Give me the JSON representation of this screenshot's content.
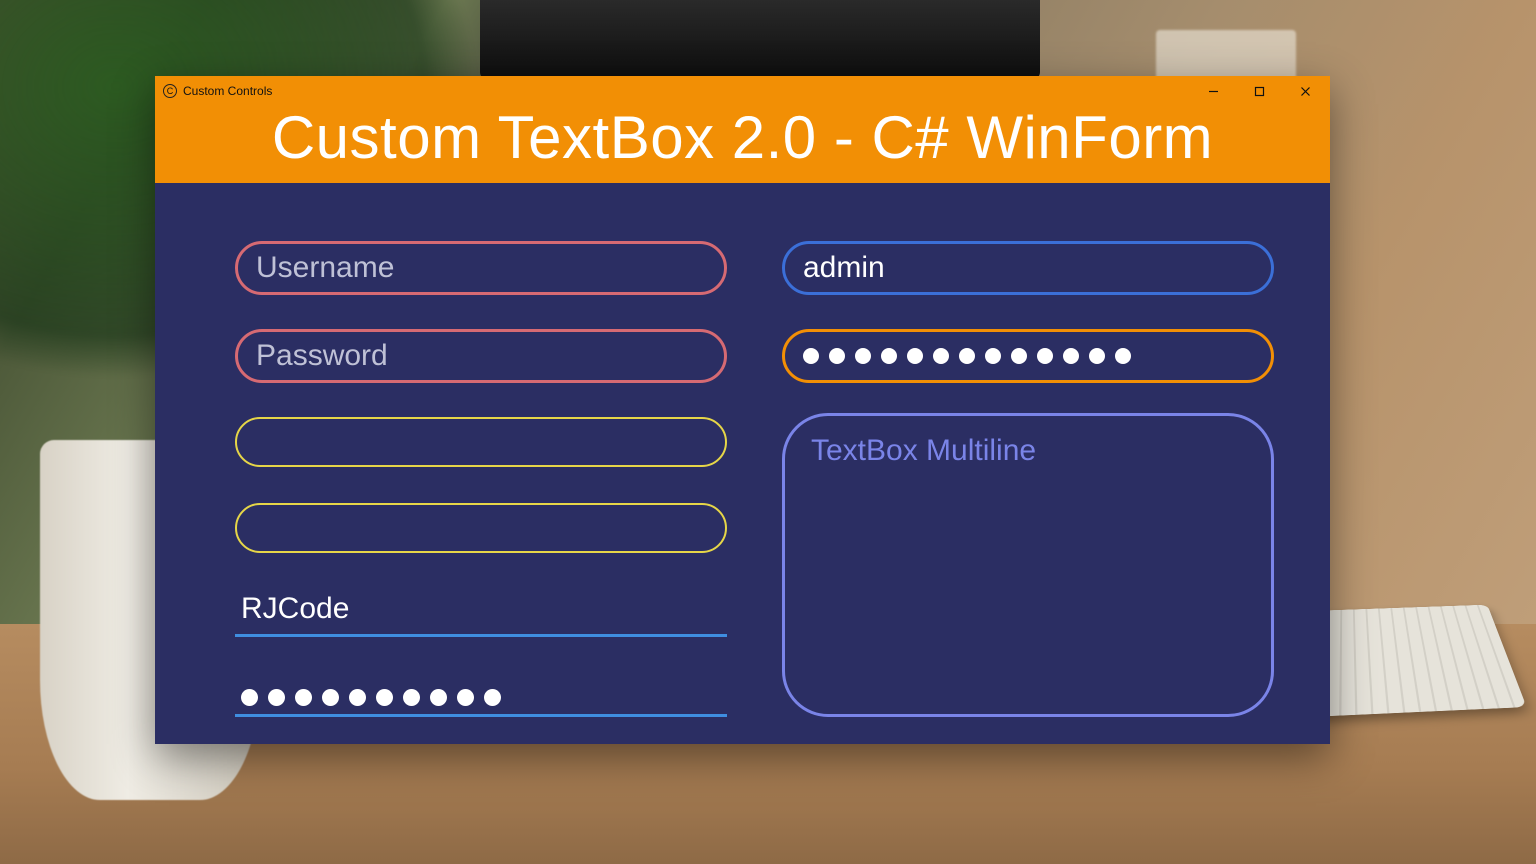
{
  "titlebar": {
    "title": "Custom Controls"
  },
  "header": {
    "heading": "Custom TextBox 2.0 - C# WinForm"
  },
  "left": {
    "username": {
      "placeholder": "Username",
      "value": ""
    },
    "password": {
      "placeholder": "Password",
      "value": ""
    },
    "box3": {
      "placeholder": "",
      "value": ""
    },
    "box4": {
      "placeholder": "",
      "value": ""
    },
    "underline_text": {
      "value": "RJCode"
    },
    "underline_password": {
      "dot_count": 10
    }
  },
  "right": {
    "username": {
      "value": "admin"
    },
    "password": {
      "dot_count": 13
    },
    "multiline": {
      "placeholder": "TextBox Multiline"
    }
  },
  "colors": {
    "window_bg": "#2b2e63",
    "accent_orange": "#f28f05",
    "border_rose": "#d66a73",
    "border_yellow": "#e6d648",
    "border_blue": "#3b6fd8",
    "border_violet": "#7a84e8",
    "underline_blue": "#3f8ee0"
  }
}
